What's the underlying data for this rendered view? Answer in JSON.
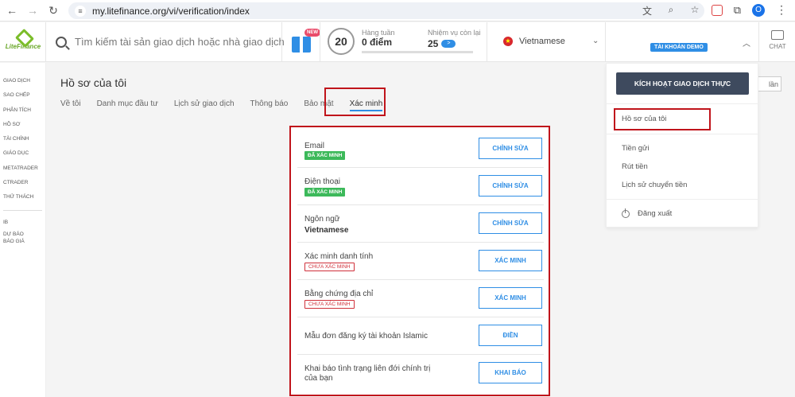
{
  "browser": {
    "url": "my.litefinance.org/vi/verification/index",
    "profile_initial": "O"
  },
  "header": {
    "brand": "LiteFinance",
    "search_placeholder": "Tìm kiếm tài sản giao dịch hoặc nhà giao dịch",
    "gift_badge": "NEW",
    "level": "20",
    "weekly_label": "Hàng tuần",
    "weekly_value": "0 điểm",
    "tasks_label": "Nhiệm vụ còn lại",
    "tasks_value": "25",
    "tasks_go": ">",
    "language": "Vietnamese",
    "account_badge": "TÀI KHOẢN DEMO",
    "chat_label": "CHAT"
  },
  "left_nav": {
    "items": [
      "GIAO DỊCH",
      "SAO CHÉP",
      "PHÂN TÍCH",
      "HỒ SƠ",
      "TÀI CHÍNH",
      "GIÁO DỤC",
      "METATRADER",
      "CTRADER",
      "THỬ THÁCH"
    ],
    "items_after": [
      "IB",
      "DỰ BÁO",
      "BÁO GIÁ"
    ]
  },
  "page": {
    "title": "Hồ sơ của tôi",
    "tabs": [
      "Về tôi",
      "Danh mục đầu tư",
      "Lịch sử giao dịch",
      "Thông báo",
      "Bảo mật",
      "Xác minh"
    ],
    "bg_button": "lần"
  },
  "verification": {
    "rows": [
      {
        "title": "Email",
        "badge": "ĐÃ XÁC MINH",
        "button": "CHỈNH SỬA"
      },
      {
        "title": "Điện thoại",
        "badge": "ĐÃ XÁC MINH",
        "button": "CHỈNH SỬA"
      },
      {
        "title": "Ngôn ngữ",
        "value": "Vietnamese",
        "button": "CHỈNH SỬA"
      },
      {
        "title": "Xác minh danh tính",
        "badge": "CHƯA XÁC MINH",
        "button": "XÁC MINH"
      },
      {
        "title": "Bằng chứng địa chỉ",
        "badge": "CHƯA XÁC MINH",
        "button": "XÁC MINH"
      },
      {
        "title": "Mẫu đơn đăng ký tài khoản Islamic",
        "button": "ĐIỀN"
      },
      {
        "title_line1": "Khai báo tình trạng liên đới chính trị",
        "title_line2": "của bạn",
        "button": "KHAI BÁO"
      }
    ]
  },
  "dropdown": {
    "activate": "KÍCH HOẠT GIAO DỊCH THỰC",
    "profile": "Hồ sơ của tôi",
    "deposit": "Tiền gửi",
    "withdraw": "Rút tiền",
    "transfer_history": "Lịch sử chuyển tiền",
    "logout": "Đăng xuất"
  },
  "colors": {
    "accent": "#2f8ee5",
    "verified": "#3cb95a",
    "unverified": "#d0303a",
    "highlight": "#c0141b",
    "dark_button": "#3e4a5e"
  }
}
